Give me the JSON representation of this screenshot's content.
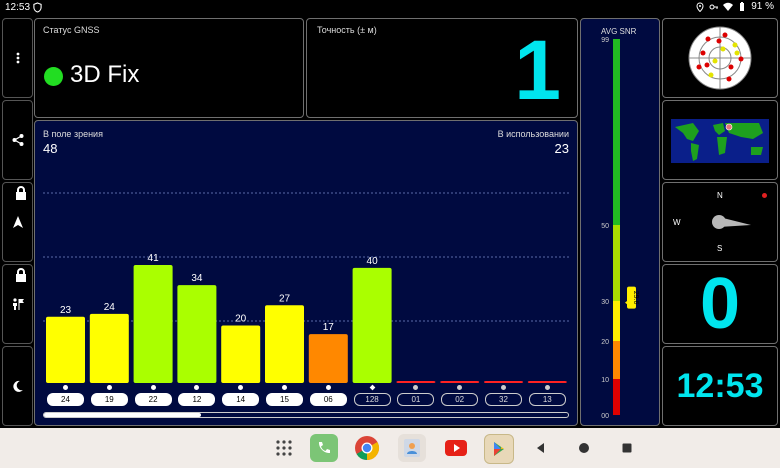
{
  "status_bar": {
    "time": "12:53",
    "battery": "91 %"
  },
  "gnss_status": {
    "label": "Статус GNSS",
    "value": "3D Fix",
    "indicator_color": "#22dd22"
  },
  "accuracy": {
    "label": "Точность (± м)",
    "value": "1"
  },
  "satellites": {
    "in_view_label": "В поле зрения",
    "in_view": "48",
    "in_use_label": "В использовании",
    "in_use": "23",
    "bars": [
      {
        "id": "24",
        "snr": 23,
        "label": "23",
        "color": "#ffff00",
        "used": true
      },
      {
        "id": "19",
        "snr": 24,
        "label": "24",
        "color": "#ffff00",
        "used": true
      },
      {
        "id": "22",
        "snr": 41,
        "label": "41",
        "color": "#aaff00",
        "used": true
      },
      {
        "id": "12",
        "snr": 34,
        "label": "34",
        "color": "#aaff00",
        "used": true
      },
      {
        "id": "14",
        "snr": 20,
        "label": "20",
        "color": "#ffff00",
        "used": true
      },
      {
        "id": "15",
        "snr": 27,
        "label": "27",
        "color": "#ffff00",
        "used": true
      },
      {
        "id": "06",
        "snr": 17,
        "label": "17",
        "color": "#ff8800",
        "used": true
      },
      {
        "id": "128",
        "snr": 40,
        "label": "40",
        "color": "#aaff00",
        "used": false
      },
      {
        "id": "01",
        "snr": 0,
        "label": "",
        "color": "#ff2222",
        "used": false
      },
      {
        "id": "02",
        "snr": 0,
        "label": "",
        "color": "#ff2222",
        "used": false
      },
      {
        "id": "32",
        "snr": 0,
        "label": "",
        "color": "#ff2222",
        "used": false
      },
      {
        "id": "13",
        "snr": 0,
        "label": "",
        "color": "#ff2222",
        "used": false
      }
    ],
    "scroll_position": 0.3
  },
  "avg_snr": {
    "label": "AVG SNR",
    "ticks": [
      "99",
      "50",
      "30",
      "20",
      "10",
      "00"
    ],
    "value": 29.6,
    "value_label": "29.6"
  },
  "compass": {
    "n": "N",
    "s": "S",
    "w": "W"
  },
  "big_counter": {
    "value": "0"
  },
  "clock": {
    "time": "12:53"
  },
  "colors": {
    "cyan": "#00e5ee",
    "navy": "#000a40",
    "green": "#22bb22",
    "yellow": "#ffff00",
    "orange": "#ff8800",
    "red": "#dd0000"
  }
}
